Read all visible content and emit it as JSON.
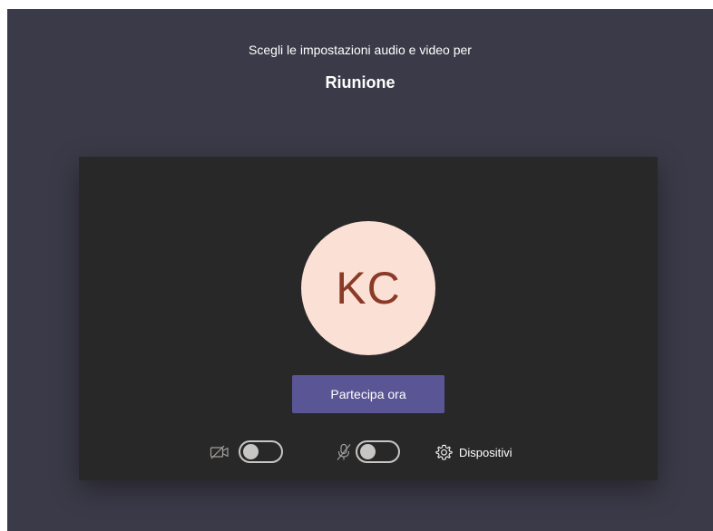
{
  "prejoin": {
    "subtitle": "Scegli le impostazioni audio e video per",
    "meeting_title": "Riunione"
  },
  "avatar": {
    "initials": "KC"
  },
  "actions": {
    "join_label": "Partecipa ora"
  },
  "controls": {
    "camera": {
      "icon": "camera-off-icon",
      "state": "off"
    },
    "microphone": {
      "icon": "mic-off-icon",
      "state": "off"
    },
    "devices_label": "Dispositivi",
    "devices_icon": "gear-icon"
  },
  "colors": {
    "background": "#3b3a48",
    "panel": "#292828",
    "accent": "#5a5594",
    "avatar_bg": "#fbe0d6",
    "avatar_text": "#8a3a27"
  }
}
